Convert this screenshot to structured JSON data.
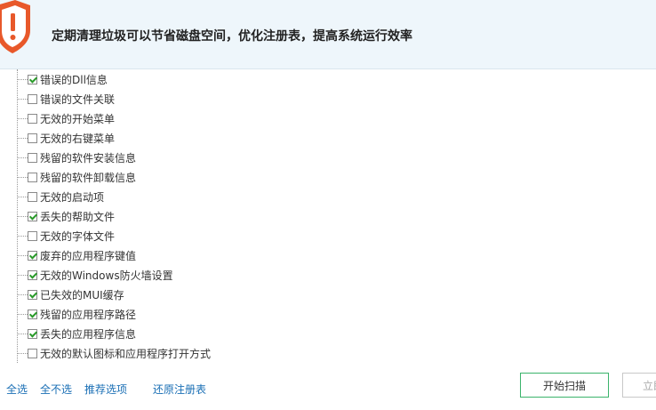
{
  "header": {
    "message": "定期清理垃圾可以节省磁盘空间，优化注册表，提高系统运行效率",
    "icon": "warning-shield-icon",
    "accent": "#e8582a"
  },
  "items": [
    {
      "label": "错误的Dll信息",
      "checked": true
    },
    {
      "label": "错误的文件关联",
      "checked": false
    },
    {
      "label": "无效的开始菜单",
      "checked": false
    },
    {
      "label": "无效的右键菜单",
      "checked": false
    },
    {
      "label": "残留的软件安装信息",
      "checked": false
    },
    {
      "label": "残留的软件卸载信息",
      "checked": false
    },
    {
      "label": "无效的启动项",
      "checked": false
    },
    {
      "label": "丢失的帮助文件",
      "checked": true
    },
    {
      "label": "无效的字体文件",
      "checked": false
    },
    {
      "label": "废弃的应用程序键值",
      "checked": true
    },
    {
      "label": "无效的Windows防火墙设置",
      "checked": true
    },
    {
      "label": "已失效的MUI缓存",
      "checked": true
    },
    {
      "label": "残留的应用程序路径",
      "checked": true
    },
    {
      "label": "丢失的应用程序信息",
      "checked": true
    },
    {
      "label": "无效的默认图标和应用程序打开方式",
      "checked": false
    }
  ],
  "footer": {
    "select_all": "全选",
    "select_none": "全不选",
    "recommended": "推荐选项",
    "restore_registry": "还原注册表",
    "start_scan": "开始扫描",
    "immediate": "立即"
  },
  "colors": {
    "link": "#1a6fb5",
    "check": "#2a9a2a",
    "scan_border": "#3bb36b"
  }
}
